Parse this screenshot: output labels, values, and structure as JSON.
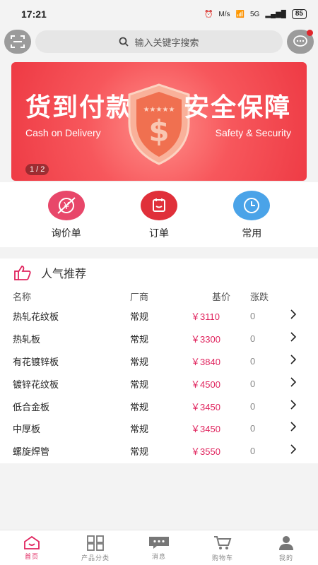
{
  "status_bar": {
    "time": "17:21",
    "network_speed": "M/s",
    "signal": "5G",
    "battery": "85"
  },
  "search": {
    "placeholder": "输入关键字搜索",
    "scan_icon": "scan-icon",
    "message_icon": "chat-icon"
  },
  "banner": {
    "left_title": "货到付款",
    "left_subtitle": "Cash on Delivery",
    "right_title": "安全保障",
    "right_subtitle": "Safety & Security",
    "pager": "1 / 2",
    "shield_icon": "dollar-shield-icon",
    "colors": {
      "background": "#ee3a44",
      "shield": "#f27a54"
    }
  },
  "quick_actions": [
    {
      "label": "询价单",
      "icon": "price-inquiry-icon",
      "color": "#e8476a"
    },
    {
      "label": "订单",
      "icon": "order-icon",
      "color": "#e0303a"
    },
    {
      "label": "常用",
      "icon": "clock-icon",
      "color": "#4aa3e8"
    }
  ],
  "recommend": {
    "title": "人气推荐",
    "icon": "thumbs-up-icon",
    "headers": {
      "name": "名称",
      "maker": "厂商",
      "price": "基价",
      "change": "涨跌"
    },
    "rows": [
      {
        "name": "热轧花纹板",
        "maker": "常规",
        "price": "￥3110",
        "change": "0"
      },
      {
        "name": "热轧板",
        "maker": "常规",
        "price": "￥3300",
        "change": "0"
      },
      {
        "name": "有花镀锌板",
        "maker": "常规",
        "price": "￥3840",
        "change": "0"
      },
      {
        "name": "镀锌花纹板",
        "maker": "常规",
        "price": "￥4500",
        "change": "0"
      },
      {
        "name": "低合金板",
        "maker": "常规",
        "price": "￥3450",
        "change": "0"
      },
      {
        "name": "中厚板",
        "maker": "常规",
        "price": "￥3450",
        "change": "0"
      },
      {
        "name": "螺旋焊管",
        "maker": "常规",
        "price": "￥3550",
        "change": "0"
      }
    ]
  },
  "tabbar": [
    {
      "label": "首页",
      "icon": "home-icon",
      "active": true
    },
    {
      "label": "产品分类",
      "icon": "category-grid-icon",
      "active": false
    },
    {
      "label": "消息",
      "icon": "message-icon",
      "active": false
    },
    {
      "label": "购物车",
      "icon": "cart-icon",
      "active": false
    },
    {
      "label": "我的",
      "icon": "profile-icon",
      "active": false
    }
  ],
  "colors": {
    "accent": "#e0245e",
    "price": "#e0245e"
  }
}
